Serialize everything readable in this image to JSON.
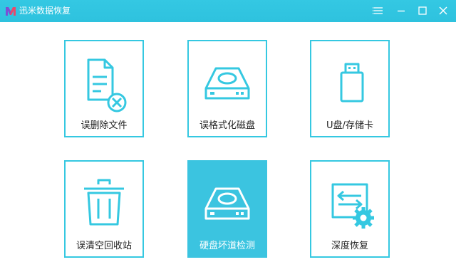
{
  "app": {
    "title": "迅米数据恢复"
  },
  "window_controls": [
    {
      "name": "menu-button",
      "icon": "menu-icon"
    },
    {
      "name": "minimize-button",
      "icon": "minimize-icon"
    },
    {
      "name": "maximize-button",
      "icon": "maximize-icon"
    },
    {
      "name": "close-button",
      "icon": "close-icon"
    }
  ],
  "tiles": [
    {
      "label": "误删除文件",
      "icon": "deleted-file-icon",
      "selected": false
    },
    {
      "label": "误格式化磁盘",
      "icon": "disk-icon",
      "selected": false
    },
    {
      "label": "U盘/存储卡",
      "icon": "usb-drive-icon",
      "selected": false
    },
    {
      "label": "误清空回收站",
      "icon": "trash-bin-icon",
      "selected": false
    },
    {
      "label": "硬盘坏道检测",
      "icon": "hard-disk-scan-icon",
      "selected": true
    },
    {
      "label": "深度恢复",
      "icon": "deep-recovery-icon",
      "selected": false
    }
  ],
  "colors": {
    "accent": "#35c8e1",
    "selected_tile": "#3bc4e0",
    "label_text": "#222222"
  }
}
